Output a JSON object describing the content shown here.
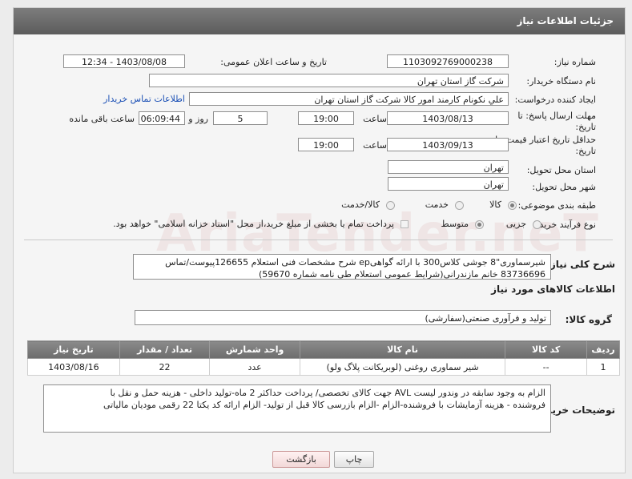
{
  "header": {
    "title": "جزئیات اطلاعات نیاز"
  },
  "fields": {
    "need_number_label": "شماره نیاز:",
    "need_number": "1103092769000238",
    "announce_label": "تاریخ و ساعت اعلان عمومی:",
    "announce_value": "1403/08/08 - 12:34",
    "buyer_org_label": "نام دستگاه خریدار:",
    "buyer_org": "شرکت گاز استان تهران",
    "creator_label": "ایجاد کننده درخواست:",
    "creator": "علي نكونام كارمند امور كالا شركت گاز استان تهران",
    "contact_link": "اطلاعات تماس خریدار",
    "deadline_label_1": "مهلت ارسال پاسخ: تا",
    "deadline_label_2": "تاریخ:",
    "deadline_date": "1403/08/13",
    "time_label": "ساعت",
    "deadline_time": "19:00",
    "days_value": "5",
    "days_label": "روز و",
    "remaining_time": "06:09:44",
    "remaining_label": "ساعت باقی مانده",
    "price_validity_label_1": "حداقل تاریخ اعتبار قیمت: تا",
    "price_validity_label_2": "تاریخ:",
    "price_validity_date": "1403/09/13",
    "price_validity_time": "19:00",
    "province_label": "استان محل تحویل:",
    "province": "تهران",
    "city_label": "شهر محل تحویل:",
    "city": "تهران",
    "category_label": "طبقه بندی موضوعی:",
    "category_options": [
      "کالا",
      "خدمت",
      "کالا/خدمت"
    ],
    "process_label": "نوع فرآیند خرید :",
    "process_options": [
      "جزیی",
      "متوسط"
    ],
    "payment_note": "پرداخت تمام یا بخشی از مبلغ خرید،از محل \"اسناد خزانه اسلامی\" خواهد بود."
  },
  "summary": {
    "label": "شرح کلی نیاز:",
    "line1": "شیرسماوری\"8 جوشی کلاس300 با ارائه گواهیep شرح مشخصات فنی استعلام 126655پیوست/تماس",
    "line2": "83736696 خانم مازندرانی(شرایط عمومی استعلام طی نامه شماره 59670)"
  },
  "goods": {
    "section_title": "اطلاعات کالاهای مورد نیاز",
    "group_label": "گروه کالا:",
    "group_value": "تولید و فرآوری صنعتی(سفارشی)",
    "columns": [
      "ردیف",
      "کد کالا",
      "نام کالا",
      "واحد شمارش",
      "تعداد / مقدار",
      "تاریخ نیاز"
    ],
    "rows": [
      [
        "1",
        "--",
        "شیر سماوری روغنی (لوبریکانت پلاگ ولو)",
        "عدد",
        "22",
        "1403/08/16"
      ]
    ]
  },
  "buyer_notes": {
    "label": "توضیحات خریدار:",
    "line1": "الزام به وجود سابقه در وندور لیست AVL جهت کالای تخصصی/ پرداخت حداکثر 2 ماه-تولید داخلی - هزینه حمل و نقل با",
    "line2": "فروشنده - هزینه آزمایشات با فروشنده-الزام  -الزام بازرسی کالا قبل از تولید- الزام ارائه کد یکتا 22 رقمی مودیان مالیاتی"
  },
  "buttons": {
    "print": "چاپ",
    "back": "بازگشت"
  },
  "watermark": "AriaTender.neT"
}
